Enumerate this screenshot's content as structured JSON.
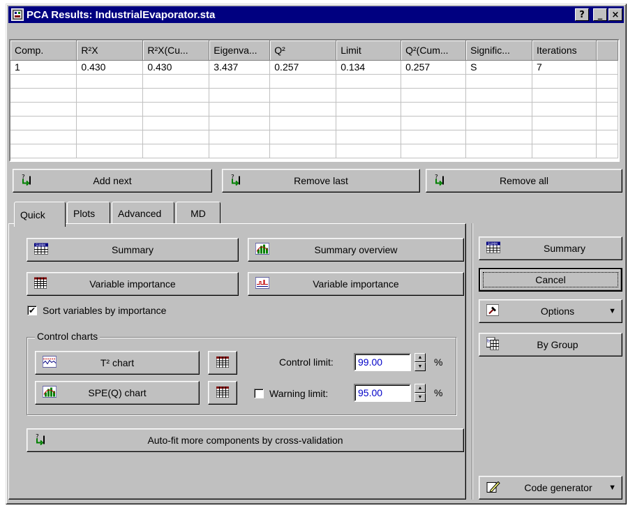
{
  "window": {
    "title": "PCA Results: IndustrialEvaporator.sta",
    "help_label": "?",
    "minimize_label": "_",
    "close_label": "×"
  },
  "grid": {
    "columns": [
      "Comp.",
      "R²X",
      "R²X(Cu...",
      "Eigenva...",
      "Q²",
      "Limit",
      "Q²(Cum...",
      "Signific...",
      "Iterations"
    ],
    "rows": [
      [
        "1",
        "0.430",
        "0.430",
        "3.437",
        "0.257",
        "0.134",
        "0.257",
        "S",
        "7"
      ]
    ]
  },
  "actions": {
    "add_next": "Add next",
    "remove_last": "Remove last",
    "remove_all": "Remove all"
  },
  "tabs": [
    "Quick",
    "Plots",
    "Advanced",
    "MD"
  ],
  "quick": {
    "summary": "Summary",
    "summary_overview": "Summary overview",
    "variable_importance_1": "Variable importance",
    "variable_importance_2": "Variable importance",
    "sort_label": "Sort variables by importance",
    "sort_checked": "✔",
    "control_charts_title": "Control charts",
    "t2_chart": "T² chart",
    "spe_chart": "SPE(Q) chart",
    "control_limit_label": "Control limit:",
    "control_limit_value": "99.00",
    "warning_limit_label": "Warning limit:",
    "warning_limit_value": "95.00",
    "percent": "%",
    "auto_fit": "Auto-fit more components by cross-validation"
  },
  "side": {
    "summary": "Summary",
    "cancel": "Cancel",
    "options": "Options",
    "by_group": "By Group",
    "code_generator": "Code generator"
  }
}
